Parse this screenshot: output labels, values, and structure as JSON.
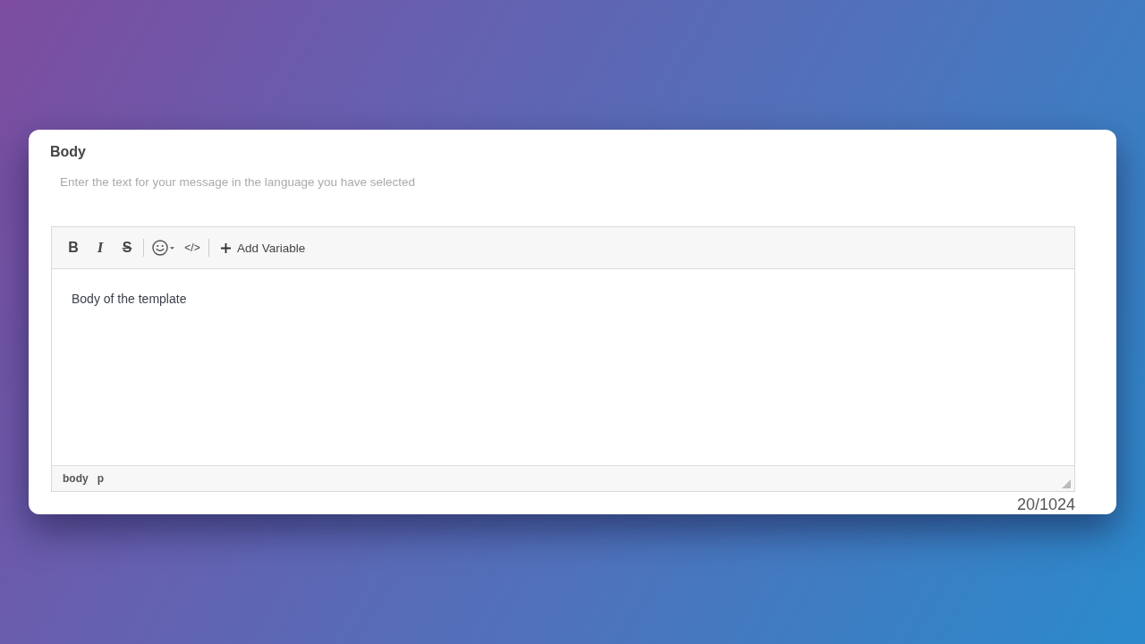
{
  "field": {
    "label": "Body",
    "description": "Enter the text for your message in the language you have selected"
  },
  "editor": {
    "toolbar": [
      {
        "buttons": [
          {
            "kind": "bold",
            "glyph": "B"
          },
          {
            "kind": "italic",
            "glyph": "I"
          },
          {
            "kind": "strikethrough",
            "glyph": "S"
          }
        ]
      },
      {
        "buttons": [
          {
            "kind": "emoji"
          },
          {
            "kind": "code",
            "glyph": "</>"
          }
        ]
      },
      {
        "buttons": [
          {
            "kind": "add-variable",
            "label": "Add Variable"
          }
        ]
      }
    ],
    "value": "Body of the template",
    "element_path": [
      "body",
      "p"
    ]
  },
  "counter": "20/1024"
}
